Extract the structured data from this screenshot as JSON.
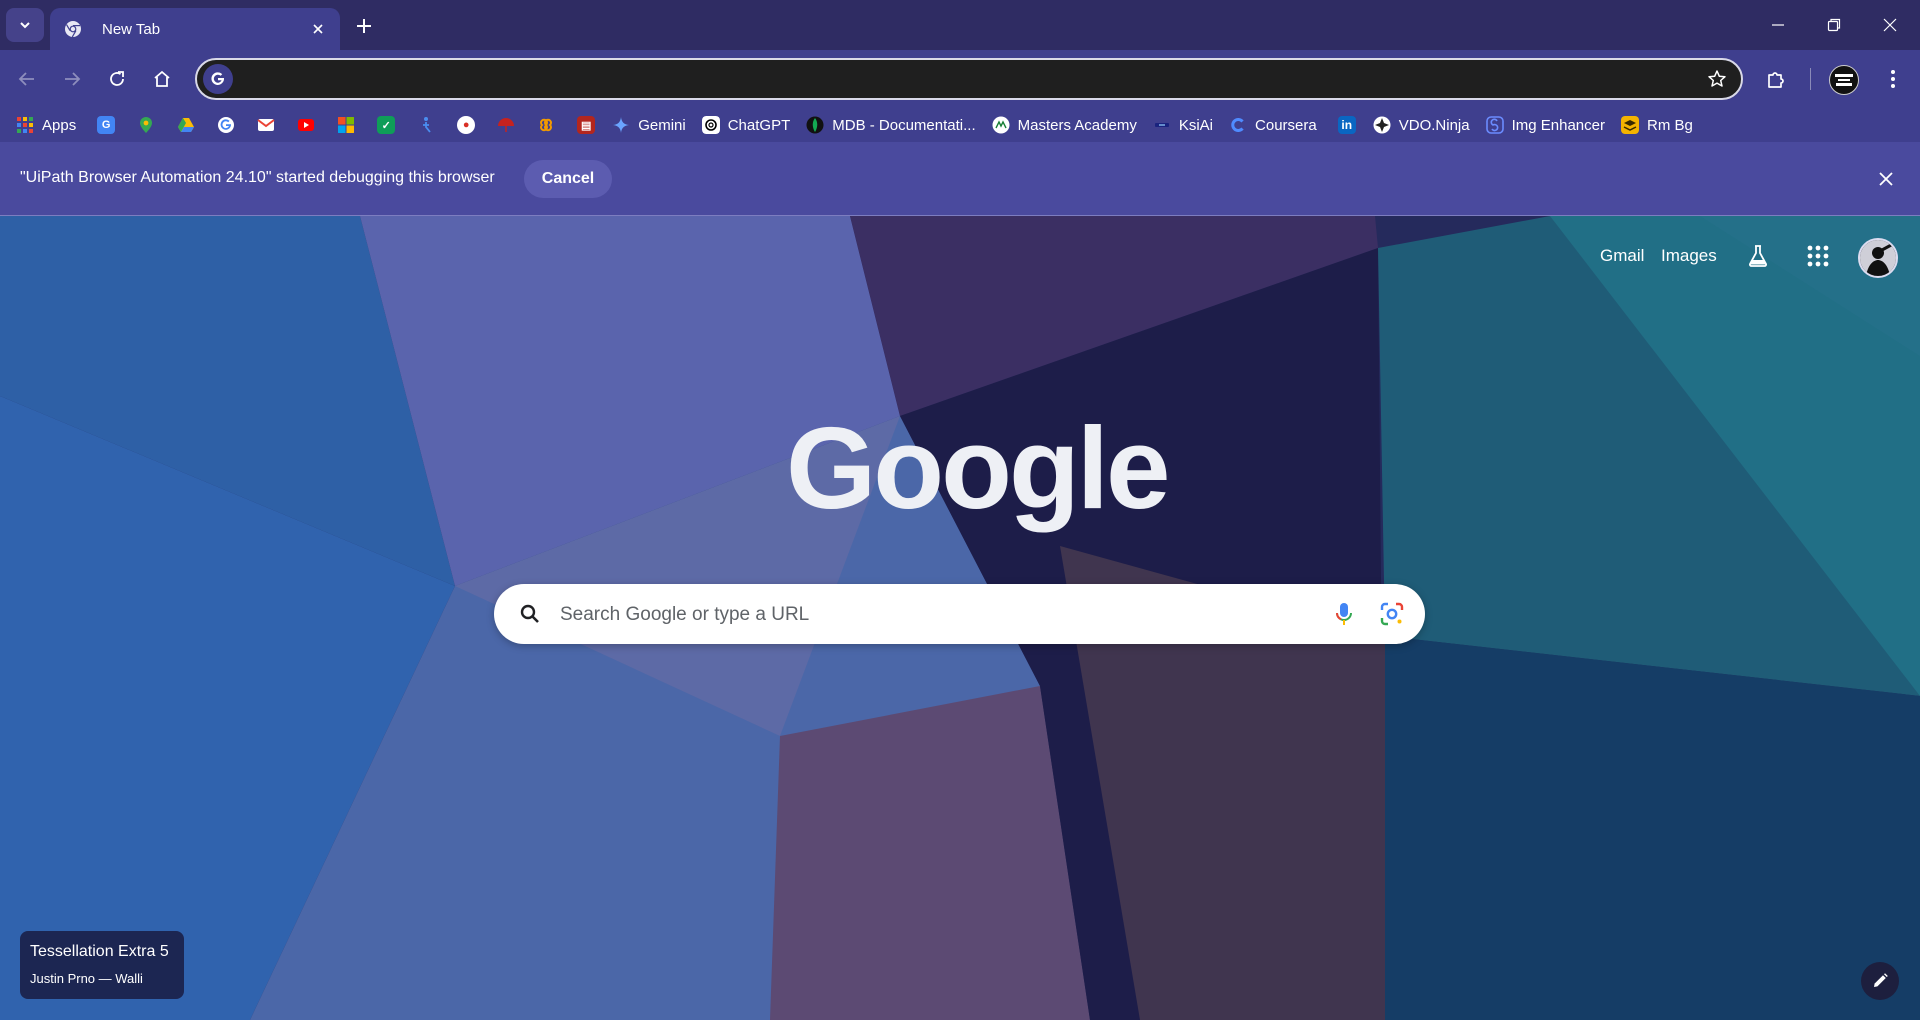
{
  "tab": {
    "title": "New Tab"
  },
  "omnibox": {
    "value": "",
    "placeholder": ""
  },
  "bookmarks": {
    "apps": "Apps",
    "gemini": "Gemini",
    "chatgpt": "ChatGPT",
    "mdb": "MDB - Documentati...",
    "masters": "Masters Academy",
    "ksiai": "KsiAi",
    "coursera": "Coursera",
    "vdo": "VDO.Ninja",
    "img": "Img Enhancer",
    "rmbg": "Rm Bg"
  },
  "infobar": {
    "message": "\"UiPath Browser Automation 24.10\" started debugging this browser",
    "cancel": "Cancel"
  },
  "ntp": {
    "gmail": "Gmail",
    "images": "Images",
    "logo": "Google",
    "search_placeholder": "Search Google or type a URL",
    "background_title": "Tessellation Extra 5",
    "background_author": "Justin Prno — Walli"
  },
  "colors": {
    "frame": "#2f2c63",
    "toolbar": "#3f3f8e",
    "infobar": "#4a4a9e",
    "omnibox": "#1f1f1f"
  }
}
